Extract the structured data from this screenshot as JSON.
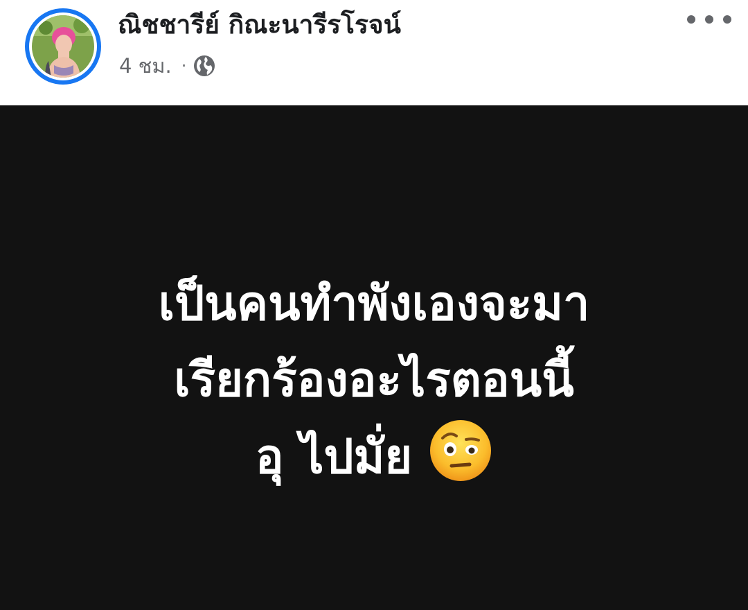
{
  "post": {
    "author_name": "ณิชชารีย์ กิณะนารีรโรจน์",
    "timestamp": "4 ชม.",
    "separator": "·",
    "privacy_icon": "globe-icon",
    "more_icon": "more-options-icon",
    "background_color": "#121212",
    "text_lines": [
      "เป็นคนทำพังเองจะมา",
      "เรียกร้องอะไรตอนนี้",
      "อุ ไปมั่ย"
    ],
    "emoji": "face-with-raised-eyebrow-emoji"
  },
  "colors": {
    "avatar_ring": "#1877f2",
    "name_text": "#1c1e21",
    "meta_text": "#65676b",
    "post_text": "#ffffff"
  }
}
